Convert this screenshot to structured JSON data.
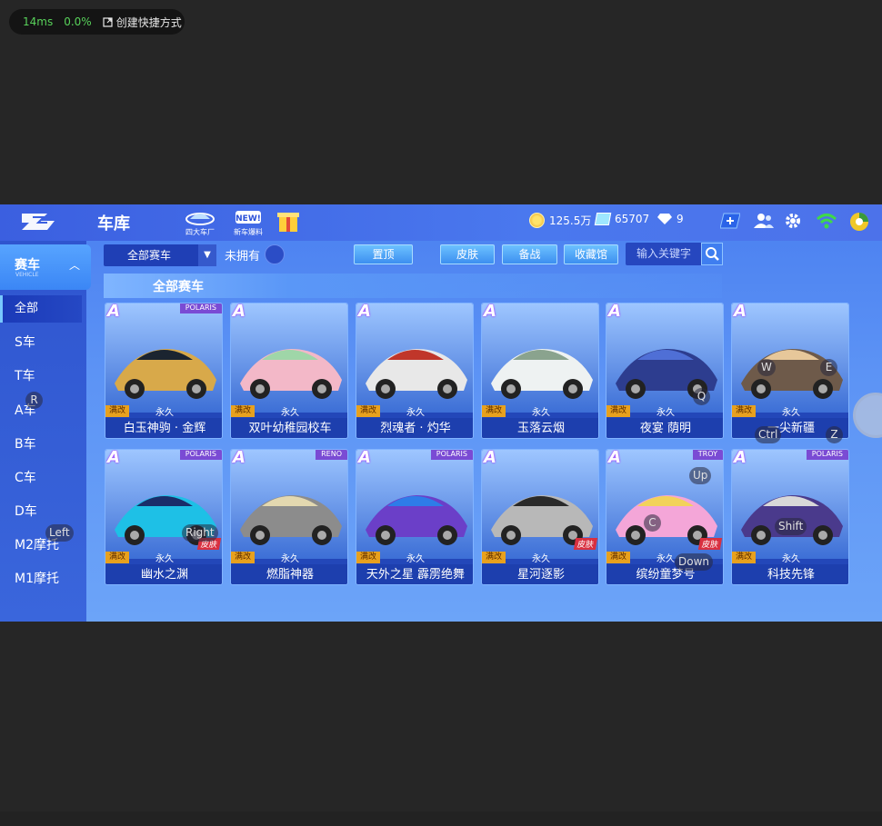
{
  "overlay": {
    "ms": "14ms",
    "pct": "0.0%",
    "shortcut": "创建快捷方式"
  },
  "header": {
    "title": "车库",
    "icons": [
      {
        "label": "四大车厂",
        "icon": "factory-icon"
      },
      {
        "label": "新车爆料",
        "icon": "new-icon"
      },
      {
        "label": "",
        "icon": "gift-icon"
      }
    ],
    "coins": "125.5万",
    "crystals": "65707",
    "diamonds": "9"
  },
  "sidebar": {
    "head": {
      "label": "赛车",
      "sub": "VEHICLE"
    },
    "items": [
      {
        "label": "全部",
        "active": true
      },
      {
        "label": "S车"
      },
      {
        "label": "T车"
      },
      {
        "label": "A车"
      },
      {
        "label": "B车"
      },
      {
        "label": "C车"
      },
      {
        "label": "D车"
      },
      {
        "label": "M2摩托"
      },
      {
        "label": "M1摩托"
      }
    ]
  },
  "filter": {
    "category": "全部赛车",
    "not_owned": "未拥有",
    "buttons": [
      "置顶",
      "皮肤",
      "备战",
      "收藏馆"
    ],
    "search_placeholder": "输入关键字"
  },
  "section": {
    "title": "全部赛车"
  },
  "cars": [
    {
      "name": "白玉神驹 · 金辉",
      "grade": "A",
      "tag": "满改",
      "duration": "永久",
      "brand": "POLARIS",
      "skin": "",
      "colors": [
        "#d8a94a",
        "#1b2430"
      ]
    },
    {
      "name": "双叶幼稚园校车",
      "grade": "A",
      "tag": "满改",
      "duration": "永久",
      "brand": "",
      "skin": "",
      "colors": [
        "#f3b8c8",
        "#9fd6a8"
      ]
    },
    {
      "name": "烈魂者 · 灼华",
      "grade": "A",
      "tag": "满改",
      "duration": "永久",
      "brand": "",
      "skin": "",
      "colors": [
        "#e8e8e8",
        "#c0362a"
      ]
    },
    {
      "name": "玉落云烟",
      "grade": "A",
      "tag": "满改",
      "duration": "永久",
      "brand": "",
      "skin": "",
      "colors": [
        "#eef2f2",
        "#8aa38e"
      ]
    },
    {
      "name": "夜宴 荫明",
      "grade": "A",
      "tag": "满改",
      "duration": "永久",
      "brand": "",
      "skin": "",
      "colors": [
        "#2d3d8f",
        "#4f6fd6"
      ]
    },
    {
      "name": "一尖新疆",
      "grade": "A",
      "tag": "满改",
      "duration": "永久",
      "brand": "",
      "skin": "",
      "colors": [
        "#6e5a4a",
        "#e7c79a"
      ]
    },
    {
      "name": "幽水之渊",
      "grade": "A",
      "tag": "满改",
      "duration": "永久",
      "brand": "POLARIS",
      "skin": "皮肤",
      "colors": [
        "#1ec0e6",
        "#1a2d6a"
      ]
    },
    {
      "name": "燃脂神器",
      "grade": "A",
      "tag": "满改",
      "duration": "永久",
      "brand": "RENO",
      "skin": "",
      "colors": [
        "#8c8c8c",
        "#e3d8b0"
      ]
    },
    {
      "name": "天外之星 霹雳绝舞",
      "grade": "A",
      "tag": "满改",
      "duration": "永久",
      "brand": "POLARIS",
      "skin": "",
      "colors": [
        "#6b3fc8",
        "#2e7ce8"
      ]
    },
    {
      "name": "星河逐影",
      "grade": "A",
      "tag": "满改",
      "duration": "永久",
      "brand": "",
      "skin": "皮肤",
      "colors": [
        "#b8b8b8",
        "#2a2a2a"
      ]
    },
    {
      "name": "缤纷童梦号",
      "grade": "A",
      "tag": "满改",
      "duration": "永久",
      "brand": "TROY",
      "skin": "皮肤",
      "colors": [
        "#f4a6d8",
        "#f2d25a"
      ]
    },
    {
      "name": "科技先锋",
      "grade": "A",
      "tag": "满改",
      "duration": "永久",
      "brand": "POLARIS",
      "skin": "",
      "colors": [
        "#4a3a8c",
        "#d8d8d8"
      ]
    }
  ],
  "keys": [
    {
      "k": "R"
    },
    {
      "k": "Left"
    },
    {
      "k": "Right"
    },
    {
      "k": "Q"
    },
    {
      "k": "W"
    },
    {
      "k": "E"
    },
    {
      "k": "Ctrl"
    },
    {
      "k": "Z"
    },
    {
      "k": "Up"
    },
    {
      "k": "C"
    },
    {
      "k": "Down"
    },
    {
      "k": "Shift"
    }
  ]
}
